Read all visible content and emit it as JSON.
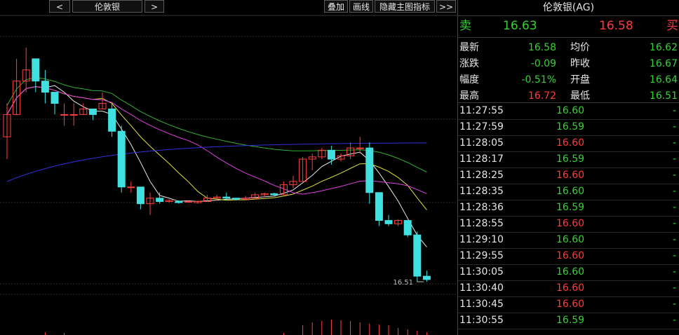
{
  "toolbar": {
    "prev_label": "<",
    "symbol_label": "伦敦银",
    "next_label": ">",
    "overlay_label": "叠加",
    "draw_label": "画线",
    "hide_indicator_label": "隐藏主图指标",
    "more_label": ">>"
  },
  "chart": {
    "low_marker_label": "16.51",
    "colors": {
      "up": "#ff4040",
      "down": "#40e0e0",
      "ma_white": "#e8e8e8",
      "ma_yellow": "#e0e040",
      "ma_magenta": "#e040e0",
      "ma_green": "#30b030",
      "ma_blue": "#3030e0"
    }
  },
  "chart_data": {
    "type": "candlestick",
    "candles": [
      {
        "o": 16.64,
        "h": 16.67,
        "l": 16.62,
        "c": 16.66
      },
      {
        "o": 16.66,
        "h": 16.71,
        "l": 16.66,
        "c": 16.69
      },
      {
        "o": 16.69,
        "h": 16.72,
        "l": 16.68,
        "c": 16.7
      },
      {
        "o": 16.71,
        "h": 16.71,
        "l": 16.68,
        "c": 16.69
      },
      {
        "o": 16.69,
        "h": 16.7,
        "l": 16.67,
        "c": 16.68
      },
      {
        "o": 16.68,
        "h": 16.68,
        "l": 16.66,
        "c": 16.67
      },
      {
        "o": 16.66,
        "h": 16.67,
        "l": 16.65,
        "c": 16.66
      },
      {
        "o": 16.66,
        "h": 16.67,
        "l": 16.65,
        "c": 16.66
      },
      {
        "o": 16.66,
        "h": 16.67,
        "l": 16.66,
        "c": 16.665
      },
      {
        "o": 16.665,
        "h": 16.665,
        "l": 16.655,
        "c": 16.66
      },
      {
        "o": 16.665,
        "h": 16.68,
        "l": 16.665,
        "c": 16.67
      },
      {
        "o": 16.665,
        "h": 16.67,
        "l": 16.64,
        "c": 16.645
      },
      {
        "o": 16.645,
        "h": 16.65,
        "l": 16.59,
        "c": 16.595
      },
      {
        "o": 16.595,
        "h": 16.6,
        "l": 16.59,
        "c": 16.595
      },
      {
        "o": 16.595,
        "h": 16.595,
        "l": 16.575,
        "c": 16.58
      },
      {
        "o": 16.58,
        "h": 16.59,
        "l": 16.57,
        "c": 16.585
      },
      {
        "o": 16.585,
        "h": 16.59,
        "l": 16.58,
        "c": 16.582
      },
      {
        "o": 16.582,
        "h": 16.584,
        "l": 16.581,
        "c": 16.583
      },
      {
        "o": 16.582,
        "h": 16.583,
        "l": 16.58,
        "c": 16.581
      },
      {
        "o": 16.582,
        "h": 16.583,
        "l": 16.582,
        "c": 16.582
      },
      {
        "o": 16.581,
        "h": 16.583,
        "l": 16.58,
        "c": 16.582
      },
      {
        "o": 16.582,
        "h": 16.588,
        "l": 16.582,
        "c": 16.585
      },
      {
        "o": 16.585,
        "h": 16.588,
        "l": 16.583,
        "c": 16.586
      },
      {
        "o": 16.586,
        "h": 16.59,
        "l": 16.583,
        "c": 16.585
      },
      {
        "o": 16.585,
        "h": 16.585,
        "l": 16.583,
        "c": 16.584
      },
      {
        "o": 16.584,
        "h": 16.587,
        "l": 16.583,
        "c": 16.585
      },
      {
        "o": 16.585,
        "h": 16.59,
        "l": 16.584,
        "c": 16.588
      },
      {
        "o": 16.588,
        "h": 16.59,
        "l": 16.586,
        "c": 16.589
      },
      {
        "o": 16.589,
        "h": 16.59,
        "l": 16.587,
        "c": 16.588
      },
      {
        "o": 16.588,
        "h": 16.6,
        "l": 16.588,
        "c": 16.597
      },
      {
        "o": 16.597,
        "h": 16.605,
        "l": 16.594,
        "c": 16.6
      },
      {
        "o": 16.6,
        "h": 16.622,
        "l": 16.6,
        "c": 16.62
      },
      {
        "o": 16.62,
        "h": 16.625,
        "l": 16.61,
        "c": 16.622
      },
      {
        "o": 16.622,
        "h": 16.63,
        "l": 16.62,
        "c": 16.628
      },
      {
        "o": 16.628,
        "h": 16.632,
        "l": 16.615,
        "c": 16.62
      },
      {
        "o": 16.62,
        "h": 16.625,
        "l": 16.618,
        "c": 16.623
      },
      {
        "o": 16.623,
        "h": 16.635,
        "l": 16.62,
        "c": 16.63
      },
      {
        "o": 16.63,
        "h": 16.64,
        "l": 16.625,
        "c": 16.63
      },
      {
        "o": 16.63,
        "h": 16.635,
        "l": 16.58,
        "c": 16.59
      },
      {
        "o": 16.59,
        "h": 16.59,
        "l": 16.56,
        "c": 16.565
      },
      {
        "o": 16.565,
        "h": 16.57,
        "l": 16.56,
        "c": 16.562
      },
      {
        "o": 16.562,
        "h": 16.566,
        "l": 16.56,
        "c": 16.565
      },
      {
        "o": 16.565,
        "h": 16.565,
        "l": 16.55,
        "c": 16.552
      },
      {
        "o": 16.552,
        "h": 16.555,
        "l": 16.51,
        "c": 16.515
      },
      {
        "o": 16.515,
        "h": 16.52,
        "l": 16.51,
        "c": 16.512
      }
    ],
    "volume_bars_visible": true
  },
  "quote": {
    "title": "伦敦银(AG)",
    "sell_label": "卖",
    "sell_price": "16.63",
    "buy_price": "16.58",
    "buy_label": "买",
    "rows": [
      {
        "k1": "最新",
        "v1": "16.58",
        "c1": "green",
        "k2": "均价",
        "v2": "16.62",
        "c2": "green"
      },
      {
        "k1": "涨跌",
        "v1": "-0.09",
        "c1": "green",
        "k2": "昨收",
        "v2": "16.67",
        "c2": "green"
      },
      {
        "k1": "幅度",
        "v1": "-0.51%",
        "c1": "green",
        "k2": "开盘",
        "v2": "16.64",
        "c2": "green"
      },
      {
        "k1": "最高",
        "v1": "16.72",
        "c1": "red",
        "k2": "最低",
        "v2": "16.51",
        "c2": "green"
      }
    ],
    "ticks": [
      {
        "time": "11:27:55",
        "price": "16.60",
        "color": "green",
        "tail": "-"
      },
      {
        "time": "11:27:59",
        "price": "16.59",
        "color": "green",
        "tail": "-"
      },
      {
        "time": "11:28:05",
        "price": "16.60",
        "color": "red",
        "tail": "-"
      },
      {
        "time": "11:28:17",
        "price": "16.59",
        "color": "green",
        "tail": "-"
      },
      {
        "time": "11:28:25",
        "price": "16.60",
        "color": "red",
        "tail": "-"
      },
      {
        "time": "11:28:35",
        "price": "16.60",
        "color": "green",
        "tail": "-"
      },
      {
        "time": "11:28:36",
        "price": "16.59",
        "color": "green",
        "tail": "-"
      },
      {
        "time": "11:28:55",
        "price": "16.60",
        "color": "red",
        "tail": "-"
      },
      {
        "time": "11:29:10",
        "price": "16.60",
        "color": "green",
        "tail": "-"
      },
      {
        "time": "11:29:55",
        "price": "16.60",
        "color": "red",
        "tail": "-"
      },
      {
        "time": "11:30:05",
        "price": "16.60",
        "color": "green",
        "tail": "-"
      },
      {
        "time": "11:30:40",
        "price": "16.60",
        "color": "red",
        "tail": "-"
      },
      {
        "time": "11:30:45",
        "price": "16.60",
        "color": "red",
        "tail": "-"
      },
      {
        "time": "11:30:55",
        "price": "16.59",
        "color": "green",
        "tail": "-"
      }
    ]
  }
}
